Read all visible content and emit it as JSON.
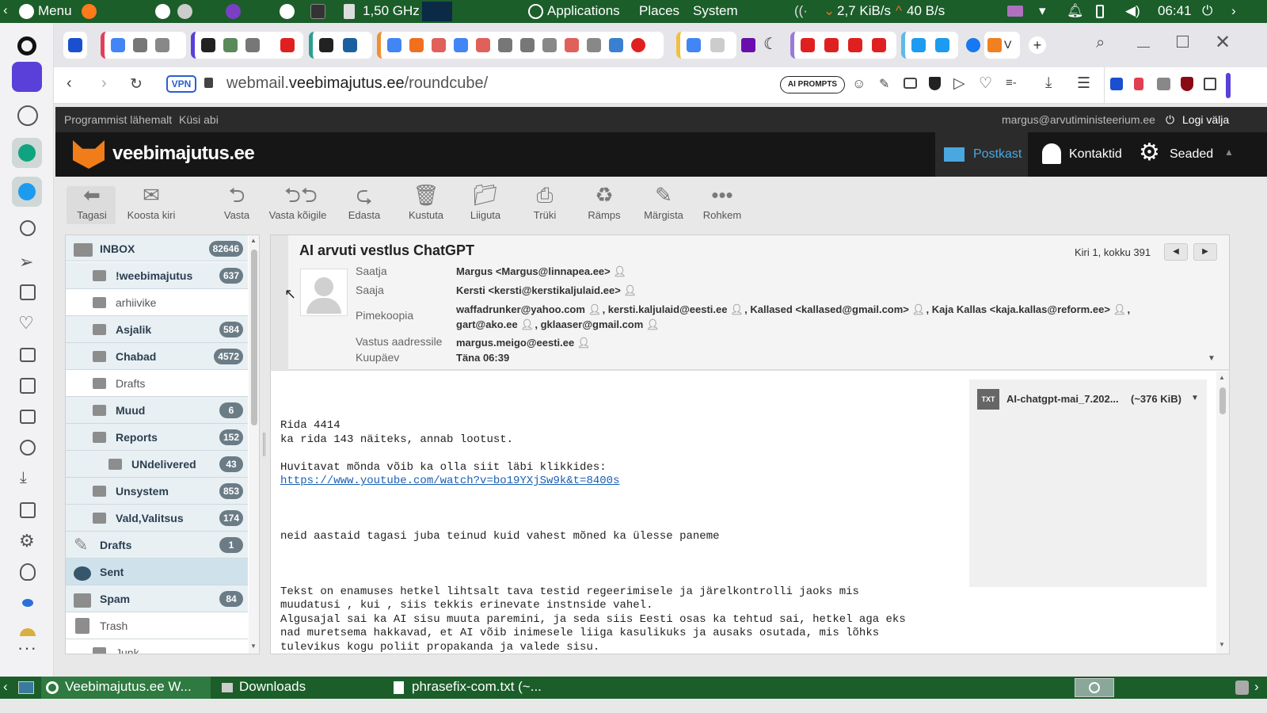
{
  "toppanel": {
    "menu": "Menu",
    "cpu": "1,50 GHz",
    "apps": "Applications",
    "places": "Places",
    "system": "System",
    "net_down": "2,7 KiB/s",
    "net_up": "40 B/s",
    "clock": "06:41"
  },
  "tabs": {
    "vivaldi_tab": "V"
  },
  "address": {
    "vpn": "VPN",
    "url_domain_prefix": "webmail.",
    "url_domain": "veebimajutus.ee",
    "url_path": "/roundcube/",
    "ai_prompts": "AI PROMPTS"
  },
  "topline": {
    "about": "Programmist lähemalt",
    "help": "Küsi abi",
    "user": "margus@arvutiministeerium.ee",
    "logout": "Logi välja"
  },
  "header": {
    "logo": "veebimajutus.ee",
    "mail": "Postkast",
    "contacts": "Kontaktid",
    "settings": "Seaded"
  },
  "toolbar": {
    "back": "Tagasi",
    "compose": "Koosta kiri",
    "reply": "Vasta",
    "reply_all": "Vasta kõigile",
    "forward": "Edasta",
    "delete": "Kustuta",
    "move": "Liiguta",
    "print": "Trüki",
    "junk": "Rämps",
    "mark": "Märgista",
    "more": "Rohkem"
  },
  "folders": [
    {
      "name": "INBOX",
      "count": "82646"
    },
    {
      "name": "!weebimajutus",
      "count": "637"
    },
    {
      "name": "arhiivike",
      "count": ""
    },
    {
      "name": "Asjalik",
      "count": "584"
    },
    {
      "name": "Chabad",
      "count": "4572"
    },
    {
      "name": "Drafts",
      "count": ""
    },
    {
      "name": "Muud",
      "count": "6"
    },
    {
      "name": "Reports",
      "count": "152"
    },
    {
      "name": "UNdelivered",
      "count": "43"
    },
    {
      "name": "Unsystem",
      "count": "853"
    },
    {
      "name": "Vald,Valitsus",
      "count": "174"
    },
    {
      "name": "Drafts",
      "count": "1"
    },
    {
      "name": "Sent",
      "count": ""
    },
    {
      "name": "Spam",
      "count": "84"
    },
    {
      "name": "Trash",
      "count": ""
    },
    {
      "name": "Junk",
      "count": ""
    }
  ],
  "message": {
    "subject": "AI arvuti vestlus ChatGPT",
    "position": "Kiri 1, kokku 391",
    "from_label": "Saatja",
    "from": "Margus <Margus@linnapea.ee>",
    "to_label": "Saaja",
    "to": "Kersti <kersti@kerstikaljulaid.ee>",
    "bcc_label": "Pimekoopia",
    "bcc1": "waffadrunker@yahoo.com",
    "bcc2": ", kersti.kaljulaid@eesti.ee",
    "bcc3": ", Kallased <kallased@gmail.com>",
    "bcc4": ", Kaja Kallas <kaja.kallas@reform.ee>",
    "bcc5": ",",
    "bcc6": "gart@ako.ee",
    "bcc7": ", gklaaser@gmail.com",
    "replyto_label": "Vastus aadressile",
    "replyto": "margus.meigo@eesti.ee",
    "date_label": "Kuupäev",
    "date": "Täna 06:39",
    "attachment": "AI-chatgpt-mai_7.202...",
    "attachment_size": "(~376 KiB)",
    "attachment_type": "TXT",
    "body_1": "Rida 4414\nka rida 143 näiteks, annab lootust.\n\nHuvitavat mõnda võib ka olla siit läbi klikkides:",
    "link": "https://www.youtube.com/watch?v=bo19YXjSw9k&t=8400s",
    "body_2": "neid aastaid tagasi juba teinud kuid vahest mõned ka ülesse paneme",
    "body_3": "Tekst on enamuses hetkel lihtsalt tava testid regeerimisele ja järelkontrolli jaoks mis\nmuudatusi , kui , siis tekkis erinevate instnside vahel.\nAlgusajal sai ka AI sisu muuta paremini, ja seda siis Eesti osas ka tehtud sai, hetkel aga eks\nnad muretsema hakkavad, et AI võib inimesele liiga kasulikuks ja ausaks osutada, mis lõhks\ntulevikus kogu poliit propakanda ja valede sisu."
  },
  "taskbar": {
    "t1": "Veebimajutus.ee W...",
    "t2": "Downloads",
    "t3": "phrasefix-com.txt (~..."
  }
}
